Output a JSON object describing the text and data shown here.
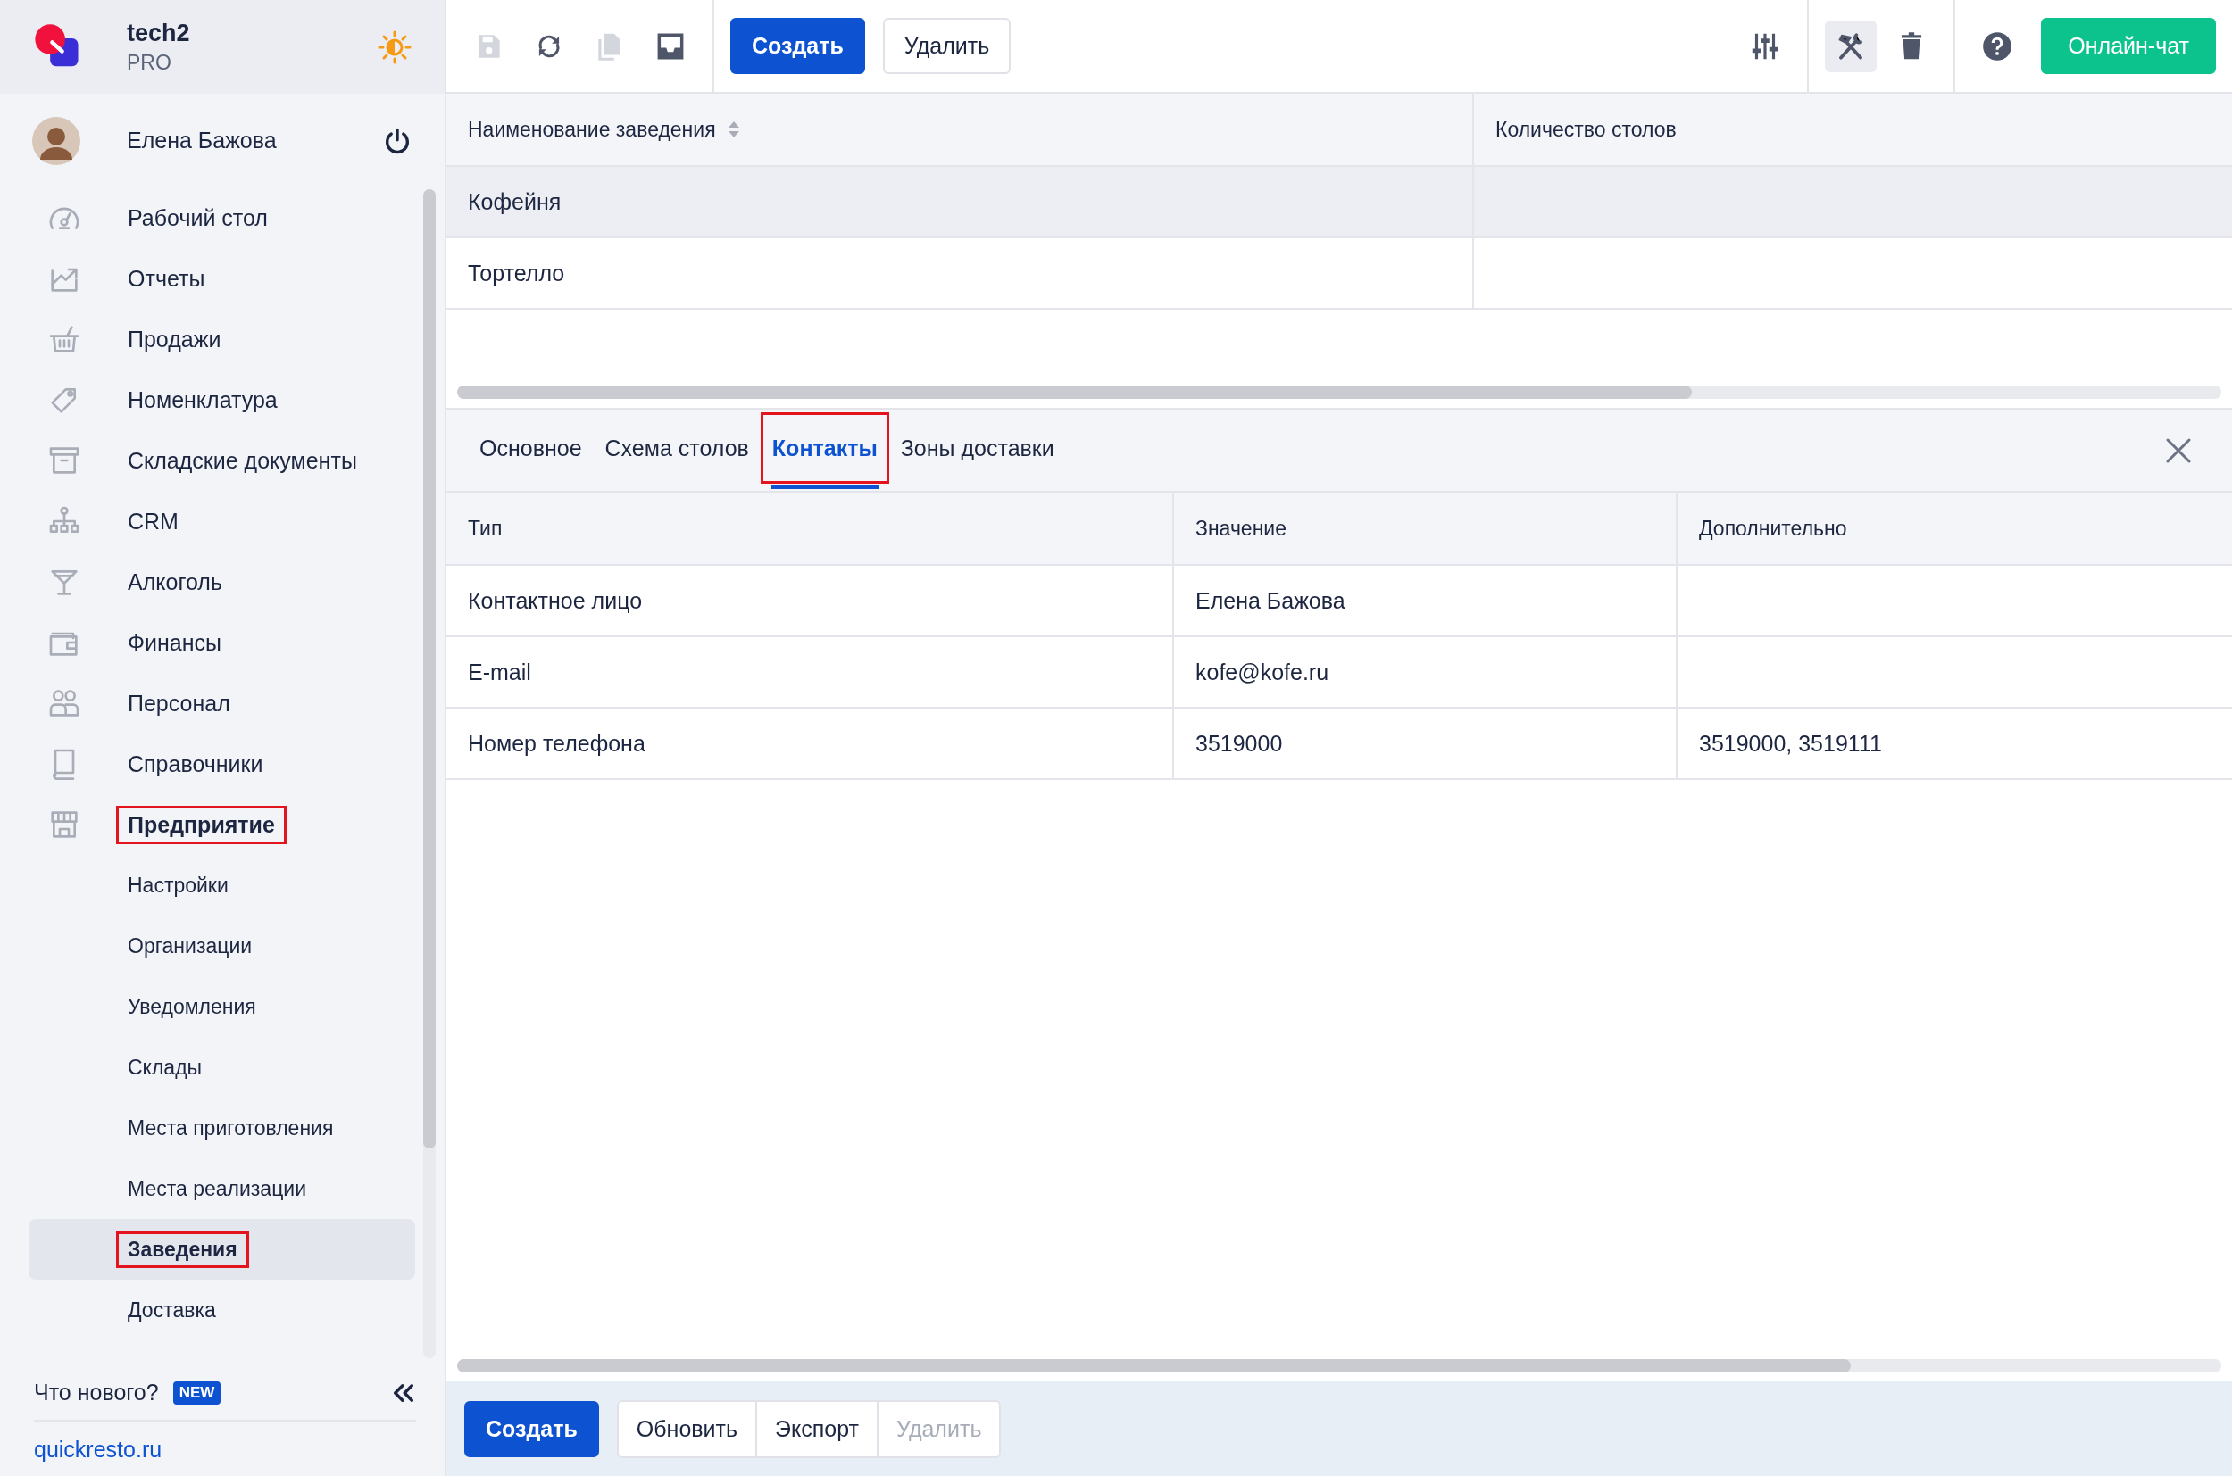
{
  "brand": {
    "name": "tech2",
    "plan": "PRO"
  },
  "user": {
    "name": "Елена Бажова"
  },
  "menu": [
    {
      "label": "Рабочий стол",
      "expanded": false,
      "annotated": false
    },
    {
      "label": "Отчеты",
      "expanded": false,
      "annotated": false
    },
    {
      "label": "Продажи",
      "expanded": false,
      "annotated": false
    },
    {
      "label": "Номенклатура",
      "expanded": false,
      "annotated": false
    },
    {
      "label": "Складские документы",
      "expanded": false,
      "annotated": false
    },
    {
      "label": "CRM",
      "expanded": false,
      "annotated": false
    },
    {
      "label": "Алкоголь",
      "expanded": false,
      "annotated": false
    },
    {
      "label": "Финансы",
      "expanded": false,
      "annotated": false
    },
    {
      "label": "Персонал",
      "expanded": false,
      "annotated": false
    },
    {
      "label": "Справочники",
      "expanded": false,
      "annotated": false
    },
    {
      "label": "Предприятие",
      "expanded": true,
      "annotated": true,
      "children": [
        {
          "label": "Настройки",
          "selected": false,
          "annotated": false
        },
        {
          "label": "Организации",
          "selected": false,
          "annotated": false
        },
        {
          "label": "Уведомления",
          "selected": false,
          "annotated": false
        },
        {
          "label": "Склады",
          "selected": false,
          "annotated": false
        },
        {
          "label": "Места приготовления",
          "selected": false,
          "annotated": false
        },
        {
          "label": "Места реализации",
          "selected": false,
          "annotated": false
        },
        {
          "label": "Заведения",
          "selected": true,
          "annotated": true
        },
        {
          "label": "Доставка",
          "selected": false,
          "annotated": false
        }
      ]
    }
  ],
  "whats_new": {
    "label": "Что нового?",
    "badge": "NEW"
  },
  "site_link": "quickresto.ru",
  "toolbar": {
    "left_icons": [
      {
        "kind": "save",
        "disabled": true
      },
      {
        "kind": "refresh",
        "disabled": false
      },
      {
        "kind": "copy",
        "disabled": true
      },
      {
        "kind": "inbox",
        "disabled": false
      }
    ],
    "create": "Создать",
    "delete": "Удалить",
    "right_icons": [
      {
        "kind": "sliders",
        "active": false
      },
      {
        "kind": "tools",
        "active": true
      },
      {
        "kind": "trash",
        "active": false
      },
      {
        "kind": "help",
        "active": false
      }
    ],
    "chat": "Онлайн-чат"
  },
  "list_table": {
    "columns": [
      {
        "label": "Наименование заведения",
        "sortable": true
      },
      {
        "label": "Количество столов",
        "sortable": false
      }
    ],
    "rows": [
      {
        "name": "Кофейня",
        "selected": true
      },
      {
        "name": "Тортелло",
        "selected": false
      }
    ]
  },
  "tabs": [
    {
      "label": "Основное",
      "selected": false,
      "annotated": false
    },
    {
      "label": "Схема столов",
      "selected": false,
      "annotated": false
    },
    {
      "label": "Контакты",
      "selected": true,
      "annotated": true
    },
    {
      "label": "Зоны доставки",
      "selected": false,
      "annotated": false
    }
  ],
  "contacts": {
    "columns": [
      "Тип",
      "Значение",
      "Дополнительно"
    ],
    "rows": [
      {
        "type": "Контактное лицо",
        "value": "Елена Бажова"
      },
      {
        "type": "E-mail",
        "value": "kofe@kofe.ru"
      },
      {
        "type": "Номер телефона",
        "value": "3519000",
        "extra": "3519000, 3519111"
      }
    ]
  },
  "footer_buttons": [
    {
      "label": "Создать",
      "kind": "primary",
      "disabled": false
    },
    {
      "label": "Обновить",
      "kind": "group",
      "disabled": false
    },
    {
      "label": "Экспорт",
      "kind": "group",
      "disabled": false
    },
    {
      "label": "Удалить",
      "kind": "group",
      "disabled": true
    }
  ]
}
